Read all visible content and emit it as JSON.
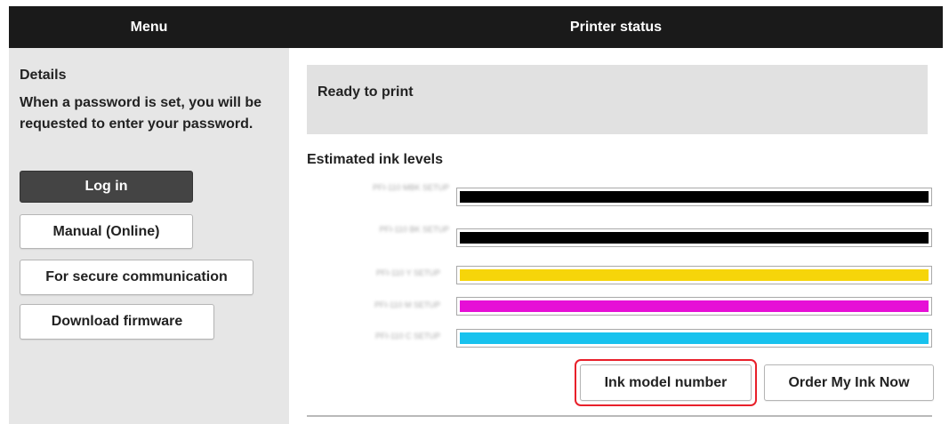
{
  "header": {
    "menu_title": "Menu",
    "status_title": "Printer status"
  },
  "sidebar": {
    "details_title": "Details",
    "details_text": "When a password is set, you will be requested to enter your password.",
    "buttons": {
      "login": "Log in",
      "manual": "Manual (Online)",
      "secure": "For secure communication",
      "firmware": "Download firmware"
    }
  },
  "main": {
    "status_text": "Ready to print",
    "ink_title": "Estimated ink levels",
    "inks": [
      {
        "label": "PFI-110 MBK SETUP",
        "color": "#000000",
        "level": 1.0
      },
      {
        "label": "PFI-110 BK SETUP",
        "color": "#000000",
        "level": 1.0
      },
      {
        "label": "PFI-110 Y SETUP",
        "color": "#f6d50a",
        "level": 1.0
      },
      {
        "label": "PFI-110 M SETUP",
        "color": "#e60fd6",
        "level": 1.0
      },
      {
        "label": "PFI-110 C SETUP",
        "color": "#18c2ee",
        "level": 1.0
      }
    ],
    "buttons": {
      "ink_model": "Ink model number",
      "order_ink": "Order My Ink Now"
    }
  },
  "colors": {
    "header_bg": "#1a1a1a",
    "sidebar_bg": "#e6e6e6",
    "highlight": "#e8202a"
  }
}
